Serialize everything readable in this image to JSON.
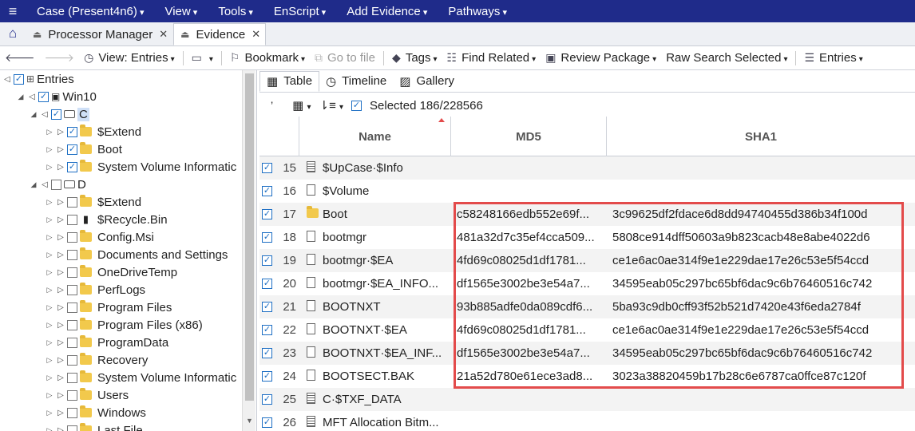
{
  "menubar": {
    "items": [
      "Case (Present4n6)",
      "View",
      "Tools",
      "EnScript",
      "Add Evidence",
      "Pathways"
    ]
  },
  "tabs": [
    {
      "label": "Processor Manager"
    },
    {
      "label": "Evidence"
    }
  ],
  "toolbar": {
    "view_entries": "View: Entries",
    "bookmark": "Bookmark",
    "go_to_file": "Go to file",
    "tags": "Tags",
    "find_related": "Find Related",
    "review_package": "Review Package",
    "raw_search_selected": "Raw Search Selected",
    "entries": "Entries"
  },
  "tree": {
    "root": "Entries",
    "win10": "Win10",
    "drive_c": "C",
    "drive_d": "D",
    "c_items": [
      "$Extend",
      "Boot",
      "System Volume Informatic"
    ],
    "d_items": [
      "$Extend",
      "$Recycle.Bin",
      "Config.Msi",
      "Documents and Settings",
      "OneDriveTemp",
      "PerfLogs",
      "Program Files",
      "Program Files (x86)",
      "ProgramData",
      "Recovery",
      "System Volume Informatic",
      "Users",
      "Windows",
      "Last File"
    ]
  },
  "viewtabs": {
    "table": "Table",
    "timeline": "Timeline",
    "gallery": "Gallery"
  },
  "subbar": {
    "selected": "Selected 186/228566"
  },
  "grid": {
    "headers": {
      "name": "Name",
      "md5": "MD5",
      "sha1": "SHA1"
    },
    "rows": [
      {
        "num": "15",
        "icon": "list",
        "name": "$UpCase·$Info",
        "md5": "",
        "sha1": ""
      },
      {
        "num": "16",
        "icon": "file",
        "name": "$Volume",
        "md5": "",
        "sha1": ""
      },
      {
        "num": "17",
        "icon": "folder",
        "name": "Boot",
        "md5": "c58248166edb552e69f...",
        "sha1": "3c99625df2fdace6d8dd94740455d386b34f100d"
      },
      {
        "num": "18",
        "icon": "file",
        "name": "bootmgr",
        "md5": "481a32d7c35ef4cca509...",
        "sha1": "5808ce914dff50603a9b823cacb48e8abe4022d6"
      },
      {
        "num": "19",
        "icon": "file",
        "name": "bootmgr·$EA",
        "md5": "4fd69c08025d1df1781...",
        "sha1": "ce1e6ac0ae314f9e1e229dae17e26c53e5f54ccd"
      },
      {
        "num": "20",
        "icon": "file",
        "name": "bootmgr·$EA_INFO...",
        "md5": "df1565e3002be3e54a7...",
        "sha1": "34595eab05c297bc65bf6dac9c6b76460516c742"
      },
      {
        "num": "21",
        "icon": "file",
        "name": "BOOTNXT",
        "md5": "93b885adfe0da089cdf6...",
        "sha1": "5ba93c9db0cff93f52b521d7420e43f6eda2784f"
      },
      {
        "num": "22",
        "icon": "file",
        "name": "BOOTNXT·$EA",
        "md5": "4fd69c08025d1df1781...",
        "sha1": "ce1e6ac0ae314f9e1e229dae17e26c53e5f54ccd"
      },
      {
        "num": "23",
        "icon": "file",
        "name": "BOOTNXT·$EA_INF...",
        "md5": "df1565e3002be3e54a7...",
        "sha1": "34595eab05c297bc65bf6dac9c6b76460516c742"
      },
      {
        "num": "24",
        "icon": "file",
        "name": "BOOTSECT.BAK",
        "md5": "21a52d780e61ece3ad8...",
        "sha1": "3023a38820459b17b28c6e6787ca0ffce87c120f"
      },
      {
        "num": "25",
        "icon": "list",
        "name": "C·$TXF_DATA",
        "md5": "",
        "sha1": ""
      },
      {
        "num": "26",
        "icon": "list",
        "name": "MFT Allocation Bitm...",
        "md5": "",
        "sha1": ""
      }
    ]
  },
  "colors": {
    "menubar": "#1f2b8a",
    "highlight": "#e34b4b",
    "checkbox": "#1e6fc4"
  }
}
